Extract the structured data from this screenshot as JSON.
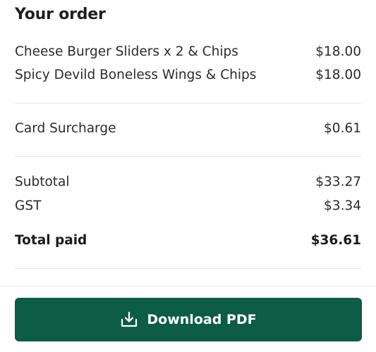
{
  "order": {
    "title": "Your order",
    "items": [
      {
        "name": "Cheese Burger Sliders x 2 & Chips",
        "price": "$18.00"
      },
      {
        "name": "Spicy Devild Boneless Wings & Chips",
        "price": "$18.00"
      }
    ],
    "surcharge": {
      "label": "Card Surcharge",
      "value": "$0.61"
    },
    "subtotal": {
      "label": "Subtotal",
      "value": "$33.27"
    },
    "gst": {
      "label": "GST",
      "value": "$3.34"
    },
    "total": {
      "label": "Total paid",
      "value": "$36.61"
    }
  },
  "actions": {
    "download_label": "Download PDF",
    "download_icon": "download-icon"
  },
  "colors": {
    "button_bg": "#0d5c45",
    "button_text": "#ffffff"
  }
}
